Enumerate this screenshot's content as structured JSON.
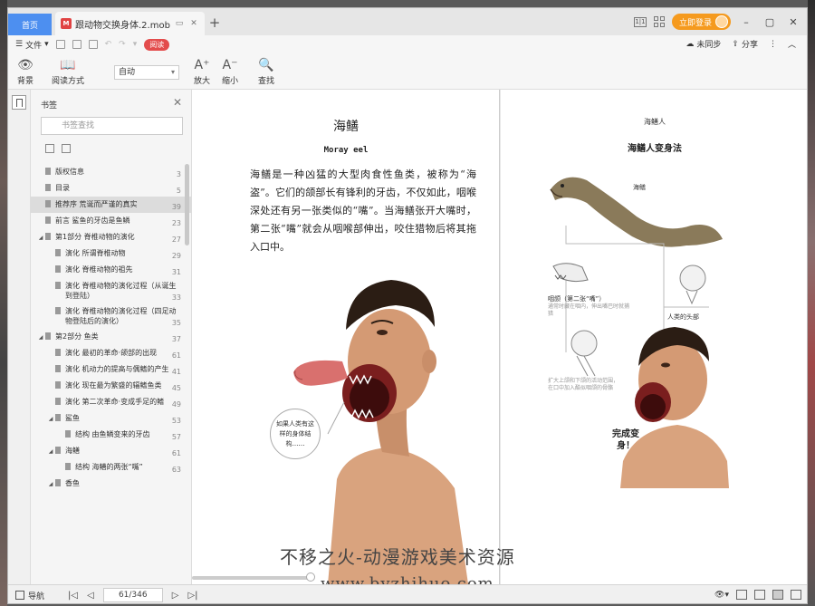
{
  "tabs": {
    "home_label": "首页",
    "doc_title": "跟动物交换身体.2.mobi"
  },
  "titlebar": {
    "login_label": "立即登录"
  },
  "menu": {
    "file_label": "文件",
    "read_badge": "阅读",
    "sync_label": "未同步",
    "share_label": "分享"
  },
  "toolbar": {
    "background_label": "背景",
    "read_mode_label": "阅读方式",
    "zoom_value": "自动",
    "zoom_in_label": "放大",
    "zoom_out_label": "缩小",
    "find_label": "查找"
  },
  "sidebar": {
    "title": "书签",
    "search_placeholder": "书签查找",
    "items": [
      {
        "title": "版权信息",
        "page": "3",
        "level": 0
      },
      {
        "title": "目录",
        "page": "5",
        "level": 0
      },
      {
        "title": "推荐序 荒诞而严谨的真实",
        "page": "39",
        "level": 0,
        "active": true
      },
      {
        "title": "前言 鲨鱼的牙齿是鱼鳞",
        "page": "23",
        "level": 0
      },
      {
        "title": "第1部分 脊椎动物的演化",
        "page": "27",
        "level": 0,
        "caret": true
      },
      {
        "title": "演化 所谓脊椎动物",
        "page": "29",
        "level": 1
      },
      {
        "title": "演化 脊椎动物的祖先",
        "page": "31",
        "level": 1
      },
      {
        "title": "演化 脊椎动物的演化过程（从诞生到登陆）",
        "page": "33",
        "level": 1
      },
      {
        "title": "演化 脊椎动物的演化过程（四足动物登陆后的演化）",
        "page": "35",
        "level": 1
      },
      {
        "title": "第2部分 鱼类",
        "page": "37",
        "level": 0,
        "caret": true
      },
      {
        "title": "演化 最初的革命·颌部的出现",
        "page": "61",
        "level": 1
      },
      {
        "title": "演化 机动力的提高与偶鳍的产生",
        "page": "41",
        "level": 1
      },
      {
        "title": "演化 现在最为繁盛的辐鳍鱼类",
        "page": "45",
        "level": 1
      },
      {
        "title": "演化 第二次革命·变成手足的鳍",
        "page": "49",
        "level": 1
      },
      {
        "title": "鲨鱼",
        "page": "53",
        "level": 1,
        "caret": true
      },
      {
        "title": "结构 由鱼鳞变来的牙齿",
        "page": "57",
        "level": 2
      },
      {
        "title": "海鳝",
        "page": "61",
        "level": 1,
        "caret": true
      },
      {
        "title": "结构 海鳝的两张“嘴”",
        "page": "63",
        "level": 2
      },
      {
        "title": "香鱼",
        "page": "",
        "level": 1,
        "caret": true
      }
    ]
  },
  "page_left": {
    "title": "海鳝",
    "subtitle": "Moray eel",
    "body": "海鳝是一种凶猛的大型肉食性鱼类，被称为“海盗”。它们的颌部长有锋利的牙齿，不仅如此，咽喉深处还有另一张类似的“嘴”。当海鳝张开大嘴时，第二张“嘴”就会从咽喉部伸出，咬住猎物后将其拖入口中。",
    "bubble_text": "如果人类有这样的身体结构……"
  },
  "page_right": {
    "header": "海鳝人",
    "title": "海鳝人变身法",
    "label_eel": "海鳝",
    "label_throat": "咽颌（第二张“嘴”）",
    "note_throat": "通常时藏在咽内，伸出嘴巴时就捕猎",
    "label_human_head": "人类的头部",
    "note_jaw": "扩大上颌和下颌的活动范围，在口中加入酷似咽颌的骨骼",
    "done_text": "完成变身！"
  },
  "watermark": {
    "line1": "不移之火-动漫游戏美术资源",
    "line2": "www.byzhihuo.com"
  },
  "statusbar": {
    "nav_label": "导航",
    "page_indicator": "61/346"
  },
  "colors": {
    "accent_blue": "#4d8ff0",
    "login_orange": "#f59a1e",
    "read_red": "#e34c4c"
  }
}
